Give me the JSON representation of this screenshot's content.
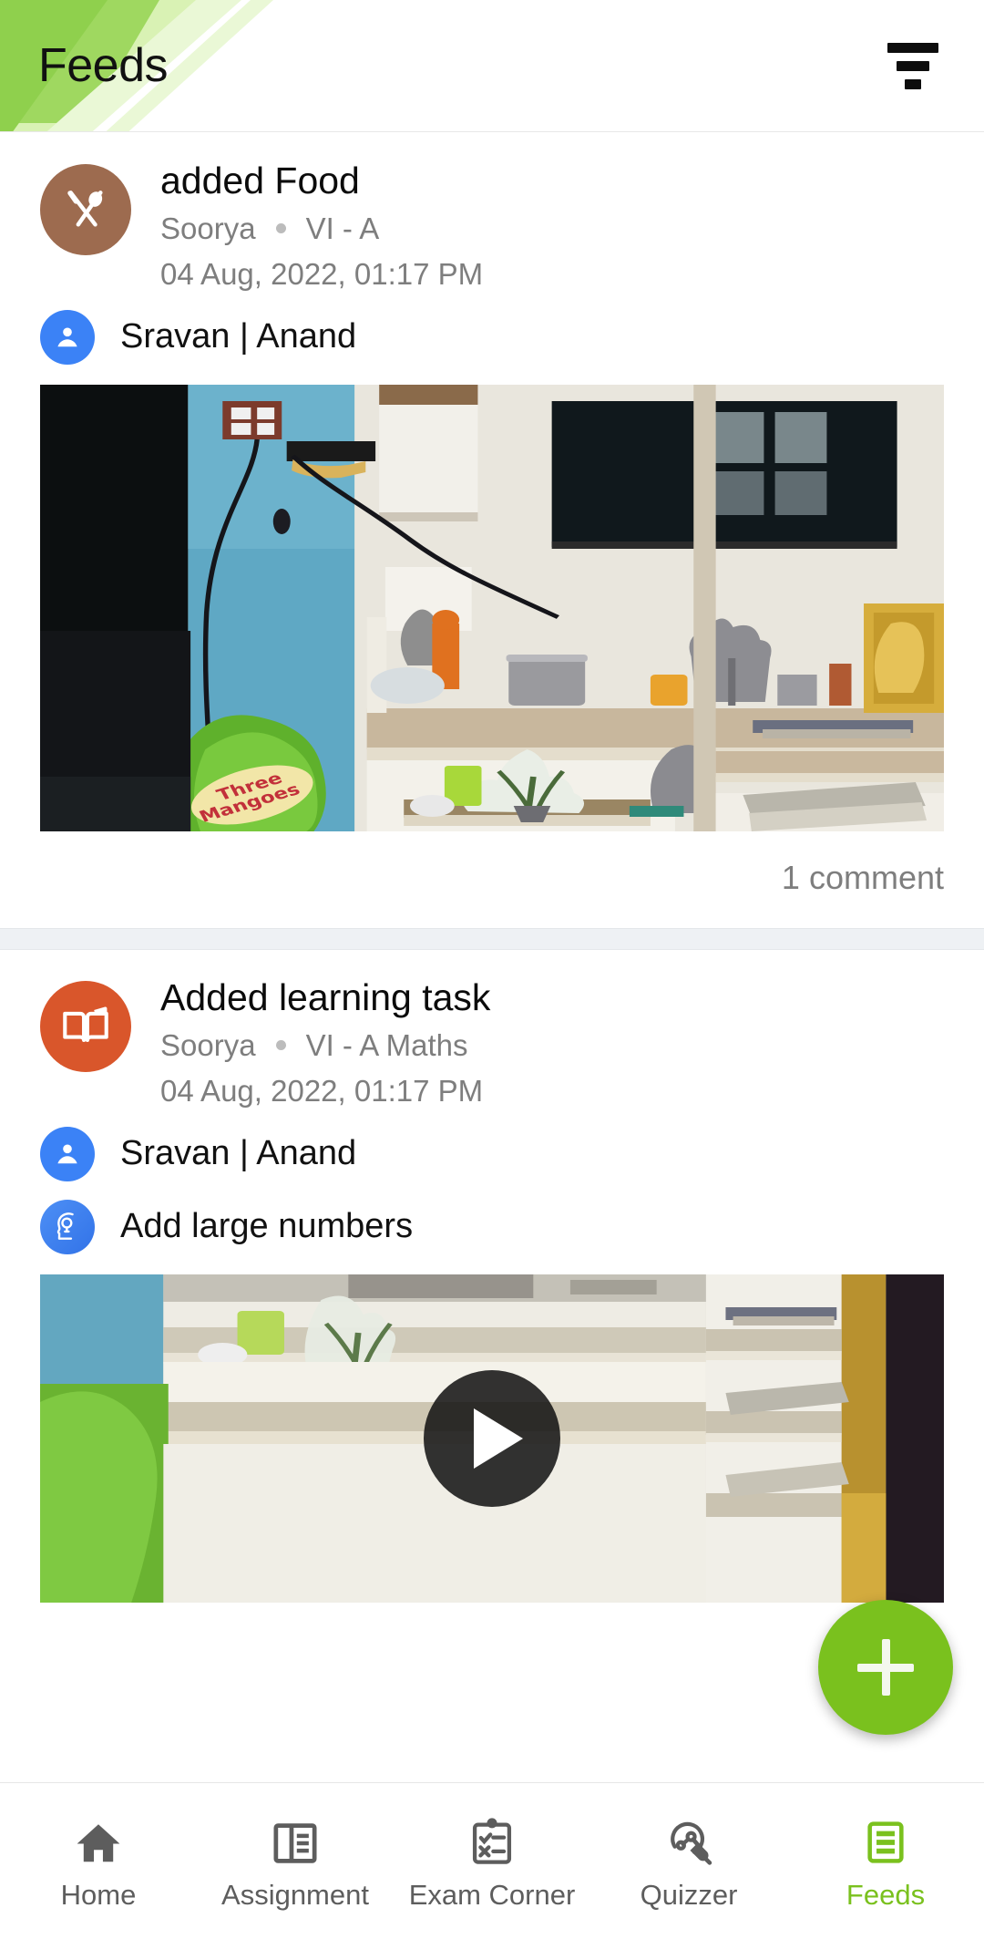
{
  "header": {
    "title": "Feeds",
    "filter_icon": "filter-icon"
  },
  "posts": [
    {
      "icon": "food-icon",
      "badge_color": "#9d6b4f",
      "title": "added Food",
      "author": "Soorya",
      "class": "VI - A",
      "timestamp": "04 Aug, 2022, 01:17 PM",
      "student_icon": "person-icon",
      "students": "Sravan  |  Anand",
      "media_type": "image",
      "comment_count": "1 comment"
    },
    {
      "icon": "open-book-icon",
      "badge_color": "#d9562b",
      "title": "Added learning task",
      "author": "Soorya",
      "class": "VI - A Maths",
      "timestamp": "04 Aug, 2022, 01:17 PM",
      "student_icon": "person-icon",
      "students": "Sravan  |  Anand",
      "task_icon": "idea-head-icon",
      "task_label": "Add large numbers",
      "media_type": "video",
      "play_icon": "play-icon"
    }
  ],
  "fab": {
    "icon": "plus-icon",
    "color": "#7ac11e"
  },
  "nav": {
    "active_color": "#7ac11e",
    "items": [
      {
        "label": "Home",
        "icon": "home-icon",
        "active": false
      },
      {
        "label": "Assignment",
        "icon": "assignment-icon",
        "active": false
      },
      {
        "label": "Exam Corner",
        "icon": "clipboard-icon",
        "active": false
      },
      {
        "label": "Quizzer",
        "icon": "bulb-plug-icon",
        "active": false
      },
      {
        "label": "Feeds",
        "icon": "feeds-list-icon",
        "active": true
      }
    ]
  }
}
